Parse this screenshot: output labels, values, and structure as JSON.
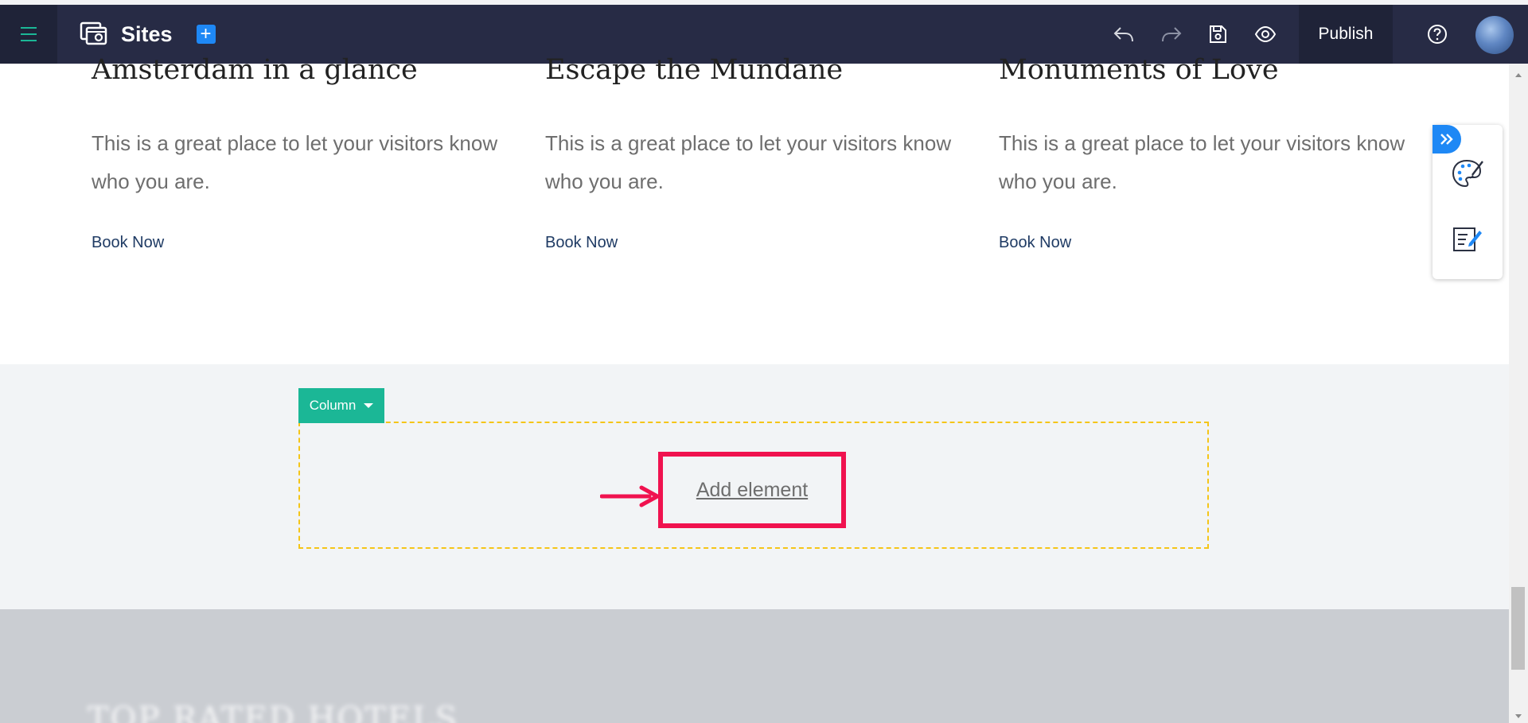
{
  "appbar": {
    "title": "Sites",
    "add_site_symbol": "+",
    "publish_label": "Publish",
    "icons": {
      "menu": "hamburger-menu-icon",
      "sites": "sites-icon",
      "undo": "undo-icon",
      "redo": "redo-icon",
      "save": "save-icon",
      "preview": "eye-icon",
      "help": "help-icon"
    }
  },
  "cards": [
    {
      "title": "Amsterdam in a glance",
      "text": "This is a great place to let your visitors know who you are.",
      "link": "Book Now"
    },
    {
      "title": "Escape the Mundane",
      "text": "This is a great place to let your visitors know who you are.",
      "link": "Book Now"
    },
    {
      "title": "Monuments of Love",
      "text": "This is a great place to let your visitors know who you are.",
      "link": "Book Now"
    }
  ],
  "column_section": {
    "tag_label": "Column",
    "add_element_label": "Add element"
  },
  "footer": {
    "blurred_heading": "TOP RATED HOTELS"
  },
  "side_panel": {
    "icons": [
      "collapse-icon",
      "palette-icon",
      "edit-icon"
    ]
  },
  "colors": {
    "appbar": "#272b45",
    "accent_blue": "#1e88f5",
    "column_tag": "#1bb796",
    "dashed_border": "#f5c518",
    "highlight": "#f0124f"
  }
}
